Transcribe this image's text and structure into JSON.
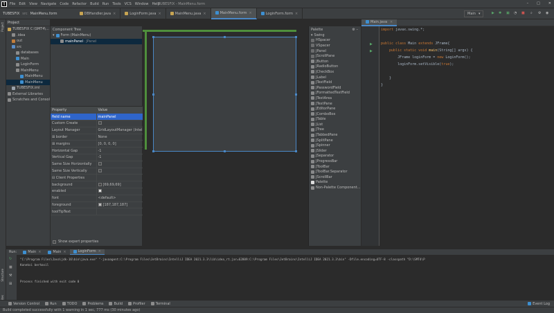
{
  "titlebar": {
    "logo": "IJ",
    "menu": [
      "File",
      "Edit",
      "View",
      "Navigate",
      "Code",
      "Refactor",
      "Build",
      "Run",
      "Tools",
      "VCS",
      "Window",
      "Help"
    ],
    "title": "TUBESFIX - MainMenu.form",
    "window_controls": [
      "–",
      "□",
      "✕"
    ]
  },
  "navbar": {
    "project": "TUBESFIX",
    "sep": "src",
    "crumb": "MainMenu.form",
    "tabs": [
      {
        "label": "DBHandler.java",
        "active": false
      },
      {
        "label": "LoginForm.java",
        "active": false
      },
      {
        "label": "MainMenu.java",
        "active": false
      },
      {
        "label": "MainMenu.form",
        "active": true
      },
      {
        "label": "LoginForm.form",
        "active": false
      }
    ],
    "run_config": "Main"
  },
  "left_strip": {
    "project_label": "Project",
    "structure_label": "Structure",
    "favorites_label": "Favorites"
  },
  "project": {
    "header": "Project",
    "items": [
      {
        "label": "TUBESFIX C:\\SMT4\\...",
        "indent": 0,
        "icon": "folder-icon",
        "color": "#c7a452",
        "selected": false
      },
      {
        "label": ".idea",
        "indent": 1,
        "icon": "folder-icon",
        "color": "#8c8c8c",
        "selected": false
      },
      {
        "label": "out",
        "indent": 1,
        "icon": "folder-icon",
        "color": "#c27d3b",
        "selected": false
      },
      {
        "label": "src",
        "indent": 1,
        "icon": "folder-icon",
        "color": "#5a8dc8",
        "selected": false
      },
      {
        "label": "databases",
        "indent": 2,
        "icon": "folder-icon",
        "color": "#8c8c8c",
        "selected": false
      },
      {
        "label": "Main",
        "indent": 2,
        "icon": "class-icon",
        "color": "#3d8fd1",
        "selected": false
      },
      {
        "label": "LoginForm",
        "indent": 2,
        "icon": "folder-icon",
        "color": "#8c8c8c",
        "selected": false
      },
      {
        "label": "MainMenu",
        "indent": 2,
        "icon": "folder-icon",
        "color": "#8c8c8c",
        "selected": false
      },
      {
        "label": "MainMenu",
        "indent": 3,
        "icon": "class-icon",
        "color": "#3d8fd1",
        "selected": false
      },
      {
        "label": "MainMenu",
        "indent": 3,
        "icon": "form-icon",
        "color": "#3d8fd1",
        "selected": true
      },
      {
        "label": "TUBESFIX.iml",
        "indent": 1,
        "icon": "file-icon",
        "color": "#9aa3ad",
        "selected": false
      },
      {
        "label": "External Libraries",
        "indent": 0,
        "icon": "library-icon",
        "color": "#8c8c8c",
        "selected": false
      },
      {
        "label": "Scratches and Consoles",
        "indent": 0,
        "icon": "scratch-icon",
        "color": "#8c8c8c",
        "selected": false
      }
    ]
  },
  "component_tree": {
    "header": "Component Tree",
    "form_label": "Form (MainMenu)",
    "panel_label": "mainPanel",
    "panel_type": ": JPanel"
  },
  "properties": {
    "col_property": "Property",
    "col_value": "Value",
    "rows": [
      {
        "key": "field name",
        "value": "mainPanel",
        "kind": "text",
        "selected": true
      },
      {
        "key": "Custom Create",
        "value": "",
        "kind": "checkbox",
        "checked": false
      },
      {
        "key": "Layout Manager",
        "value": "GridLayoutManager (IntelliJ)",
        "kind": "text"
      },
      {
        "key": "⊞ border",
        "value": "None",
        "kind": "text"
      },
      {
        "key": "⊞ margins",
        "value": "[0, 0, 0, 0]",
        "kind": "text"
      },
      {
        "key": "Horizontal Gap",
        "value": "-1",
        "kind": "text"
      },
      {
        "key": "Vertical Gap",
        "value": "-1",
        "kind": "text"
      },
      {
        "key": "Same Size Horizontally",
        "value": "",
        "kind": "checkbox",
        "checked": false
      },
      {
        "key": "Same Size Vertically",
        "value": "",
        "kind": "checkbox",
        "checked": false
      },
      {
        "key": "⊟ Client Properties",
        "value": "",
        "kind": "text"
      },
      {
        "key": "background",
        "value": "[69,69,69]",
        "kind": "color",
        "swatch": "#454545"
      },
      {
        "key": "enabled",
        "value": "",
        "kind": "checkbox",
        "checked": true
      },
      {
        "key": "font",
        "value": "<default>",
        "kind": "text"
      },
      {
        "key": "foreground",
        "value": "[187,187,187]",
        "kind": "color",
        "swatch": "#bbbbbb"
      },
      {
        "key": "toolTipText",
        "value": "",
        "kind": "text"
      }
    ],
    "show_expert": "Show expert properties"
  },
  "palette": {
    "header": "Palette",
    "group": "Swing",
    "items": [
      "HSpacer",
      "VSpacer",
      "JPanel",
      "JScrollPane",
      "JButton",
      "JRadioButton",
      "JCheckBox",
      "JLabel",
      "JTextField",
      "JPasswordField",
      "JFormattedTextField",
      "JTextArea",
      "JTextPane",
      "JEditorPane",
      "JComboBox",
      "JTable",
      "JList",
      "JTree",
      "JTabbedPane",
      "JSplitPane",
      "JSpinner",
      "JSlider",
      "JSeparator",
      "JProgressBar",
      "JToolBar",
      "JToolBar.Separator",
      "JScrollBar"
    ],
    "footer": [
      "Palette",
      "Non-Palette Component..."
    ]
  },
  "editor": {
    "tab": "Main.java",
    "lines": [
      [
        {
          "t": "import ",
          "c": "kw"
        },
        {
          "t": "javax.swing.*;",
          "c": "it2"
        }
      ],
      [],
      [
        {
          "t": "public class ",
          "c": "kw"
        },
        {
          "t": "Main ",
          "c": "it2"
        },
        {
          "t": "extends ",
          "c": "kw"
        },
        {
          "t": "JFrame{",
          "c": "it2"
        }
      ],
      [
        {
          "t": "    public static void ",
          "c": "kw"
        },
        {
          "t": "main",
          "c": "fn"
        },
        {
          "t": "(String[] args) {",
          "c": "it2"
        }
      ],
      [
        {
          "t": "        JFrame loginForm = ",
          "c": "it2"
        },
        {
          "t": "new ",
          "c": "kw"
        },
        {
          "t": "LoginForm();",
          "c": "it2"
        }
      ],
      [
        {
          "t": "        loginForm.setVisible(",
          "c": "it2"
        },
        {
          "t": "true",
          "c": "kw"
        },
        {
          "t": ");",
          "c": "it2"
        }
      ],
      [],
      [
        {
          "t": "    }",
          "c": "it2"
        }
      ],
      [
        {
          "t": "}",
          "c": "it2"
        }
      ]
    ]
  },
  "run": {
    "label": "Run:",
    "tabs": [
      {
        "label": "Main",
        "active": false
      },
      {
        "label": "Main",
        "active": false
      },
      {
        "label": "LoginForm",
        "active": true
      }
    ],
    "console": [
      "\"C:\\Program Files\\Java\\jdk-16\\bin\\java.exe\" \"-javaagent:C:\\Program Files\\JetBrains\\IntelliJ IDEA 2021.3.3\\lib\\idea_rt.jar=62809:C:\\Program Files\\JetBrains\\IntelliJ IDEA 2021.3.3\\bin\" -Dfile.encoding=UTF-8 -classpath \"D:\\SMT4\\P",
      "Koneksi berhasil",
      "",
      "",
      "Process finished with exit code 0"
    ]
  },
  "bottom_tabs": [
    "Version Control",
    "Run",
    "TODO",
    "Problems",
    "Build",
    "Profiler",
    "Terminal"
  ],
  "event_log": "Event Log",
  "status": "Build completed successfully with 1 warning in 1 sec, 777 ms (30 minutes ago)"
}
